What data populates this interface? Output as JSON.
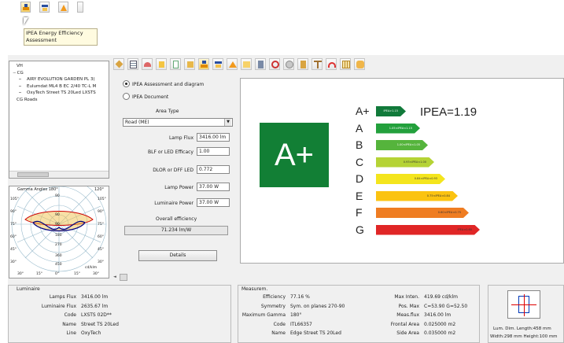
{
  "tooltip": {
    "line1": "IPEA Energy Efficiency",
    "line2": "Assessment"
  },
  "tree": {
    "items": [
      {
        "label": "VH",
        "level": 0,
        "expander": ""
      },
      {
        "label": "CG",
        "level": 0,
        "expander": "−"
      },
      {
        "label": "AIRY EVOLUTION GARDEN PL 3(",
        "level": 1,
        "expander": ""
      },
      {
        "label": "Eulumdat ML4 B EC 2/40 TC-L M",
        "level": 1,
        "expander": ""
      },
      {
        "label": "OxyTech Street TS 20Led LXSTS",
        "level": 1,
        "expander": ""
      },
      {
        "label": "CG Roads",
        "level": 0,
        "expander": ""
      }
    ]
  },
  "polar": {
    "title_left": "Gamma Angles  180°",
    "title_right": "120°",
    "left_labels": [
      "105°",
      "90°",
      "75°",
      "60°",
      "45°",
      "30°"
    ],
    "right_labels": [
      "105°",
      "90°",
      "75°",
      "60°",
      "45°",
      "30°"
    ],
    "center_labels": [
      "90",
      "90",
      "90",
      "180",
      "270",
      "360",
      "450"
    ],
    "bottom_labels": [
      "30°",
      "15°",
      "0°",
      "15°",
      "30°"
    ],
    "unit_label": "cd/klm"
  },
  "form": {
    "radio1": "IPEA Assessment and diagram",
    "radio2": "IPEA Document",
    "area_type_label": "Area Type",
    "area_type_value": "Road (ME)",
    "lamp_flux_label": "Lamp Flux",
    "lamp_flux_value": "3416.00 lm",
    "blf_label": "BLF or LED Efficacy",
    "blf_value": "1.00",
    "dldr_label": "DLOR or DFF LED",
    "dldr_value": "0.772",
    "lamp_power_label": "Lamp Power",
    "lamp_power_value": "37.00 W",
    "lum_power_label": "Luminaire Power",
    "lum_power_value": "37.00 W",
    "overall_label": "Overall efficiency",
    "overall_value": "71.234 lm/W",
    "details_button": "Details"
  },
  "rating": {
    "big_label": "A+",
    "big_color": "#127f35",
    "ipea_text": "IPEA=1.19",
    "classes": [
      {
        "letter": "A+",
        "color": "#117a3a",
        "range": "IPEA>1.15"
      },
      {
        "letter": "A",
        "color": "#23a03c",
        "range": "1.05<IPEA<1.15"
      },
      {
        "letter": "B",
        "color": "#55b43c",
        "range": "1.00<IPEA<1.05"
      },
      {
        "letter": "C",
        "color": "#b5d335",
        "range": "0.93<IPEA<1.00"
      },
      {
        "letter": "D",
        "color": "#f4e51d",
        "range": "0.84<IPEA<0.93"
      },
      {
        "letter": "E",
        "color": "#fbc311",
        "range": "0.75<IPEA<0.84"
      },
      {
        "letter": "F",
        "color": "#ef7d22",
        "range": "0.60<IPEA<0.75"
      },
      {
        "letter": "G",
        "color": "#e02626",
        "range": "IPEA<0.60"
      }
    ]
  },
  "luminaire": {
    "title": "Luminaire",
    "rows": [
      {
        "label": "Lamps Flux",
        "value": "3416.00 lm"
      },
      {
        "label": "Luminaire Flux",
        "value": "2635.67 lm"
      },
      {
        "label": "Code",
        "value": "LXSTS 02D**"
      },
      {
        "label": "Name",
        "value": "Street TS 20Led"
      },
      {
        "label": "Line",
        "value": "OxyTech"
      }
    ]
  },
  "measures": {
    "title": "Measurem.",
    "left": [
      {
        "label": "Efficiency",
        "value": "77.16 %"
      },
      {
        "label": "Symmetry",
        "value": "Sym. on planes 270-90"
      },
      {
        "label": "Maximum Gamma",
        "value": "180°"
      },
      {
        "label": "Code",
        "value": "ITL66357"
      },
      {
        "label": "Name",
        "value": "Edge Street TS 20Led"
      }
    ],
    "right": [
      {
        "label": "Max Inten.",
        "value": "419.69  cd/klm"
      },
      {
        "label": "Pos. Max",
        "value": "C=53.90 G=52.50"
      },
      {
        "label": "Meas.flux",
        "value": "3416.00 lm"
      },
      {
        "label": "Frontal Area",
        "value": "0.025000 m2"
      },
      {
        "label": "Side Area",
        "value": "0.035000 m2"
      }
    ]
  },
  "dims": {
    "line1": "Lum. Dim.   Length:458 mm",
    "line2": "Width:298 mm Height:100 mm"
  },
  "scroll_left": "◄",
  "scroll_right": "►"
}
